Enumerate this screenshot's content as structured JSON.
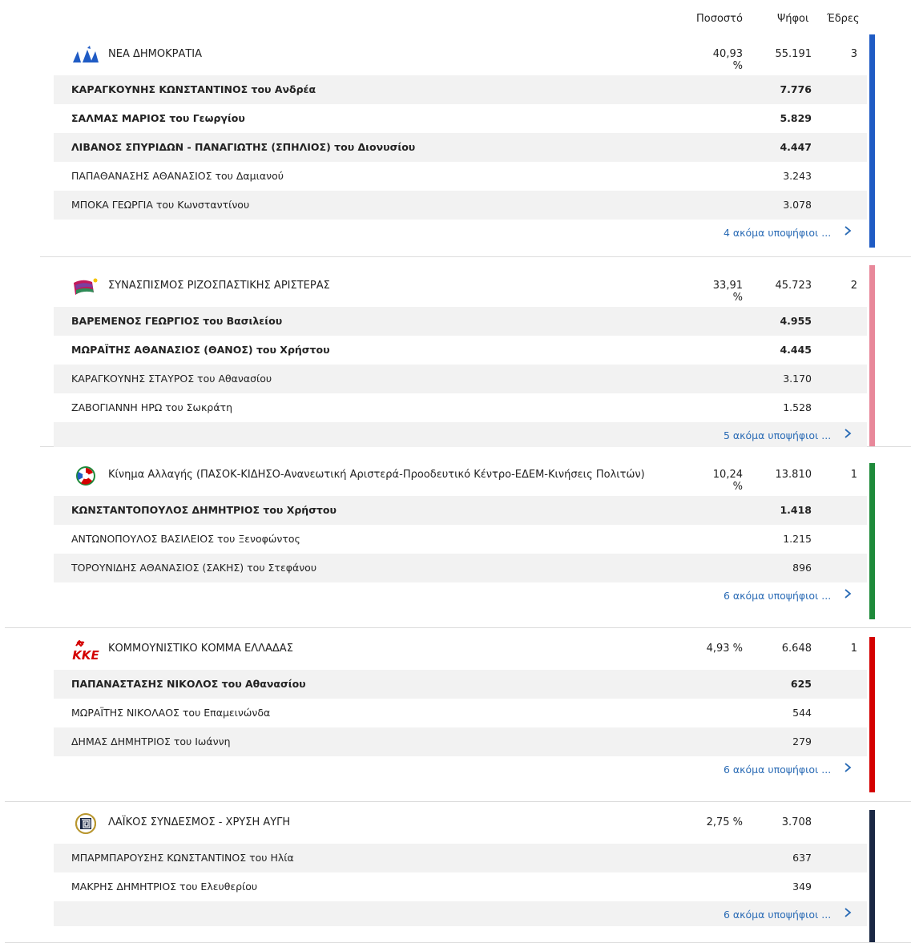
{
  "header": {
    "pct_label": "Ποσοστό",
    "votes_label": "Ψήφοι",
    "seats_label": "Έδρες"
  },
  "parties": [
    {
      "name": "ΝΕΑ ΔΗΜΟΚΡΑΤΙΑ",
      "pct": "40,93 %",
      "votes": "55.191",
      "seats": "3",
      "color": "#1f5bc4",
      "logo": "nd-logo",
      "candidates": [
        {
          "name": "ΚΑΡΑΓΚΟΥΝΗΣ ΚΩΝΣΤΑΝΤΙΝΟΣ του Ανδρέα",
          "votes": "7.776",
          "elected": true
        },
        {
          "name": "ΣΑΛΜΑΣ ΜΑΡΙΟΣ του Γεωργίου",
          "votes": "5.829",
          "elected": true
        },
        {
          "name": "ΛΙΒΑΝΟΣ ΣΠΥΡΙΔΩΝ - ΠΑΝΑΓΙΩΤΗΣ (ΣΠΗΛΙΟΣ) του Διονυσίου",
          "votes": "4.447",
          "elected": true
        },
        {
          "name": "ΠΑΠΑΘΑΝΑΣΗΣ ΑΘΑΝΑΣΙΟΣ του Δαμιανού",
          "votes": "3.243",
          "elected": false
        },
        {
          "name": "ΜΠΟΚΑ ΓΕΩΡΓΙΑ του Κωνσταντίνου",
          "votes": "3.078",
          "elected": false
        }
      ],
      "more": "4 ακόμα υποψήφιοι ..."
    },
    {
      "name": "ΣΥΝΑΣΠΙΣΜΟΣ ΡΙΖΟΣΠΑΣΤΙΚΗΣ ΑΡΙΣΤΕΡΑΣ",
      "pct": "33,91 %",
      "votes": "45.723",
      "seats": "2",
      "color": "#e8889a",
      "logo": "syriza-logo",
      "candidates": [
        {
          "name": "ΒΑΡΕΜΕΝΟΣ ΓΕΩΡΓΙΟΣ του Βασιλείου",
          "votes": "4.955",
          "elected": true
        },
        {
          "name": "ΜΩΡΑΪΤΗΣ ΑΘΑΝΑΣΙΟΣ (ΘΑΝΟΣ) του Χρήστου",
          "votes": "4.445",
          "elected": true
        },
        {
          "name": "ΚΑΡΑΓΚΟΥΝΗΣ ΣΤΑΥΡΟΣ του Αθανασίου",
          "votes": "3.170",
          "elected": false
        },
        {
          "name": "ΖΑΒΟΓΙΑΝΝΗ ΗΡΩ του Σωκράτη",
          "votes": "1.528",
          "elected": false
        }
      ],
      "more": "5 ακόμα υποψήφιοι ..."
    },
    {
      "name": "Κίνημα Αλλαγής (ΠΑΣΟΚ-ΚΙΔΗΣΟ-Ανανεωτική Αριστερά-Προοδευτικό Κέντρο-ΕΔΕΜ-Κινήσεις Πολιτών)",
      "pct": "10,24 %",
      "votes": "13.810",
      "seats": "1",
      "color": "#1e8a3a",
      "logo": "kinal-logo",
      "candidates": [
        {
          "name": "ΚΩΝΣΤΑΝΤΟΠΟΥΛΟΣ ΔΗΜΗΤΡΙΟΣ του Χρήστου",
          "votes": "1.418",
          "elected": true
        },
        {
          "name": "ΑΝΤΩΝΟΠΟΥΛΟΣ ΒΑΣΙΛΕΙΟΣ του Ξενοφώντος",
          "votes": "1.215",
          "elected": false
        },
        {
          "name": "ΤΟΡΟΥΝΙΔΗΣ ΑΘΑΝΑΣΙΟΣ (ΣΑΚΗΣ) του Στεφάνου",
          "votes": "896",
          "elected": false
        }
      ],
      "more": "6 ακόμα υποψήφιοι ..."
    },
    {
      "name": "ΚΟΜΜΟΥΝΙΣΤΙΚΟ ΚΟΜΜΑ ΕΛΛΑΔΑΣ",
      "pct": "4,93 %",
      "votes": "6.648",
      "seats": "1",
      "color": "#d40000",
      "logo": "kke-logo",
      "logo_text": "ΚΚΕ",
      "candidates": [
        {
          "name": "ΠΑΠΑΝΑΣΤΑΣΗΣ ΝΙΚΟΛΟΣ του Αθανασίου",
          "votes": "625",
          "elected": true
        },
        {
          "name": "ΜΩΡΑΪΤΗΣ ΝΙΚΟΛΑΟΣ του Επαμεινώνδα",
          "votes": "544",
          "elected": false
        },
        {
          "name": "ΔΗΜΑΣ ΔΗΜΗΤΡΙΟΣ του Ιωάννη",
          "votes": "279",
          "elected": false
        }
      ],
      "more": "6 ακόμα υποψήφιοι ..."
    },
    {
      "name": "ΛΑΪΚΟΣ ΣΥΝΔΕΣΜΟΣ - ΧΡΥΣΗ ΑΥΓΗ",
      "pct": "2,75 %",
      "votes": "3.708",
      "seats": "",
      "color": "#1a2744",
      "logo": "xa-logo",
      "candidates": [
        {
          "name": "ΜΠΑΡΜΠΑΡΟΥΣΗΣ ΚΩΝΣΤΑΝΤΙΝΟΣ του Ηλία",
          "votes": "637",
          "elected": false
        },
        {
          "name": "ΜΑΚΡΗΣ ΔΗΜΗΤΡΙΟΣ του Ελευθερίου",
          "votes": "349",
          "elected": false
        }
      ],
      "more": "6 ακόμα υποψήφιοι ..."
    }
  ]
}
